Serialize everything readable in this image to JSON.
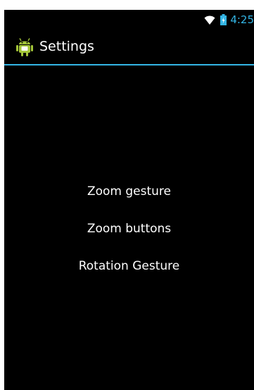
{
  "status_bar": {
    "time": "4:25",
    "accent_color": "#33b5e5"
  },
  "action_bar": {
    "icon": "android-icon",
    "title": "Settings"
  },
  "menu": {
    "items": [
      {
        "label": "Zoom gesture"
      },
      {
        "label": "Zoom buttons"
      },
      {
        "label": "Rotation Gesture"
      }
    ]
  }
}
